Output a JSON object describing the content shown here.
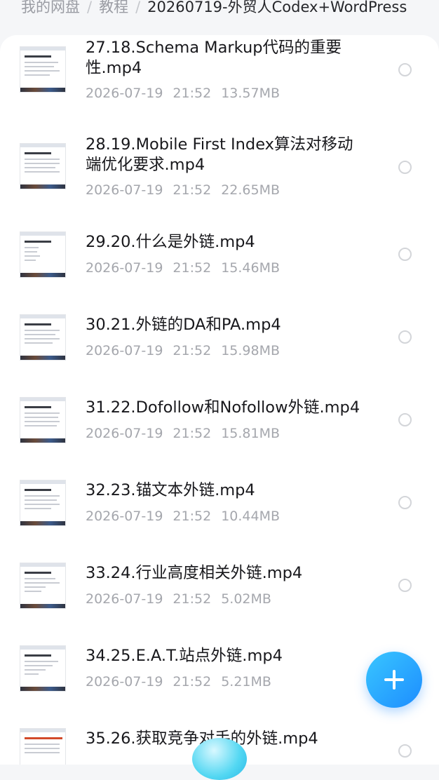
{
  "breadcrumb": {
    "items": [
      "我的网盘",
      "教程"
    ],
    "current": "20260719-外贸人Codex+WordPress"
  },
  "files": [
    {
      "name": "27.18.Schema Markup代码的重要性.mp4",
      "date": "2026-07-19",
      "time": "21:52",
      "size": "13.57MB"
    },
    {
      "name": "28.19.Mobile First Index算法对移动端优化要求.mp4",
      "date": "2026-07-19",
      "time": "21:52",
      "size": "22.65MB"
    },
    {
      "name": "29.20.什么是外链.mp4",
      "date": "2026-07-19",
      "time": "21:52",
      "size": "15.46MB"
    },
    {
      "name": "30.21.外链的DA和PA.mp4",
      "date": "2026-07-19",
      "time": "21:52",
      "size": "15.98MB"
    },
    {
      "name": "31.22.Dofollow和Nofollow外链.mp4",
      "date": "2026-07-19",
      "time": "21:52",
      "size": "15.81MB"
    },
    {
      "name": "32.23.锚文本外链.mp4",
      "date": "2026-07-19",
      "time": "21:52",
      "size": "10.44MB"
    },
    {
      "name": "33.24.行业高度相关外链.mp4",
      "date": "2026-07-19",
      "time": "21:52",
      "size": "5.02MB"
    },
    {
      "name": "34.25.E.A.T.站点外链.mp4",
      "date": "2026-07-19",
      "time": "21:52",
      "size": "5.21MB"
    },
    {
      "name": "35.26.获取竞争对手的外链.mp4",
      "date": "",
      "time": "",
      "size": ""
    }
  ],
  "icons": {
    "file_thumbnail": "video-thumbnail-icon",
    "select": "radio-circle-icon",
    "add": "plus-icon"
  },
  "colors": {
    "accent": "#1d8dff",
    "text_primary": "#18181c",
    "text_secondary": "#a5a7ad"
  }
}
